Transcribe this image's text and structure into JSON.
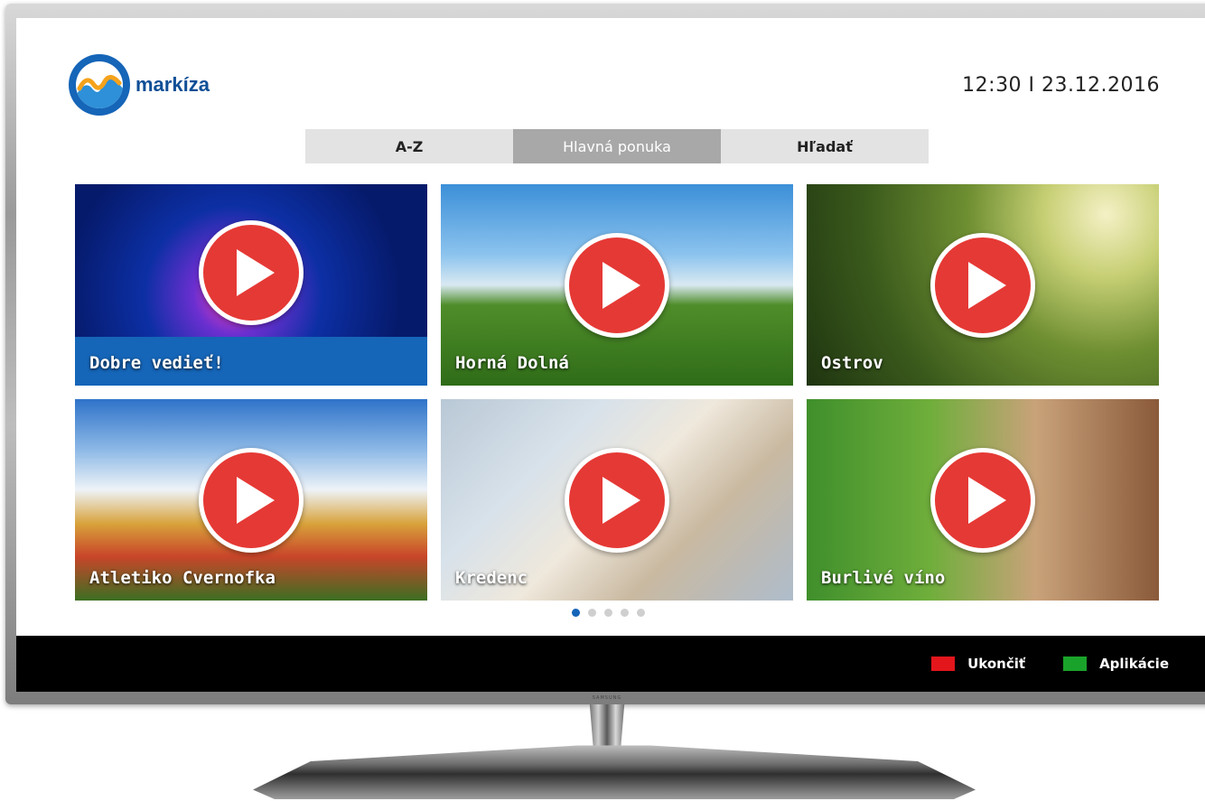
{
  "header": {
    "logo_text": "markíza",
    "datetime": "12:30 I 23.12.2016"
  },
  "tabs": [
    {
      "label": "A-Z",
      "active": false
    },
    {
      "label": "Hlavná ponuka",
      "active": true
    },
    {
      "label": "Hľadať",
      "active": false
    }
  ],
  "tiles": [
    {
      "title": "Dobre vedieť!",
      "featured": true
    },
    {
      "title": "Horná Dolná",
      "featured": false
    },
    {
      "title": "Ostrov",
      "featured": false
    },
    {
      "title": "Atletiko Cvernofka",
      "featured": false
    },
    {
      "title": "Kredenc",
      "featured": false
    },
    {
      "title": "Burlivé víno",
      "featured": false
    }
  ],
  "pagination": {
    "pages": 5,
    "current": 1
  },
  "footer": {
    "keys": [
      {
        "label": "Ukončiť",
        "color": "#e3161c"
      },
      {
        "label": "Aplikácie",
        "color": "#1aa32a"
      }
    ]
  },
  "tv_brand": "SAMSUNG",
  "colors": {
    "accent": "#1565b8",
    "play": "#e53935",
    "footer_bg": "#000000"
  }
}
